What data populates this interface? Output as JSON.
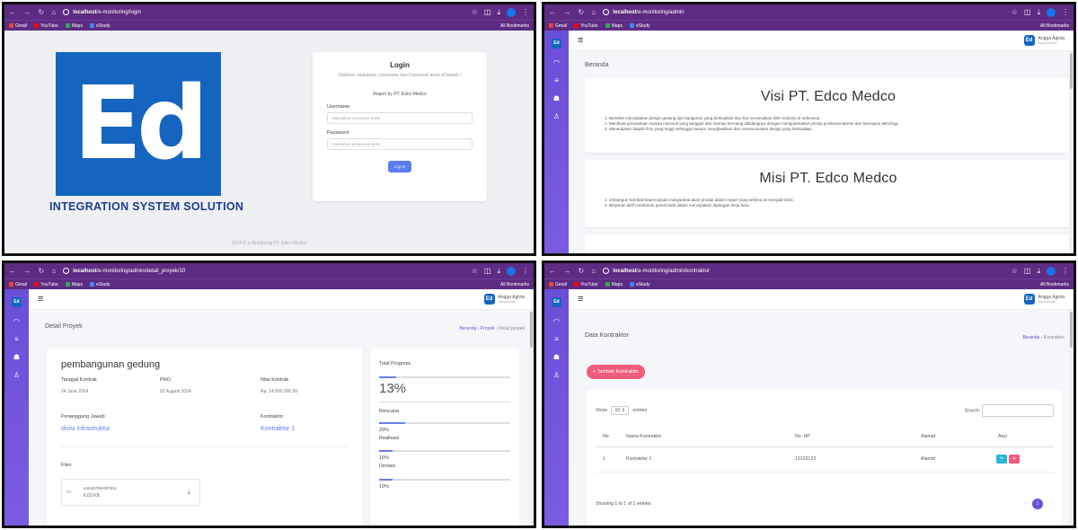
{
  "bookmarks": {
    "gmail": "Gmail",
    "youtube": "YouTube",
    "maps": "Maps",
    "estudy": "eStudy",
    "all": "All Bookmarks"
  },
  "p1": {
    "url_host": "localhost",
    "url_path": "/e-monitoring/login",
    "logo_text": "Ed",
    "tagline": "INTEGRATION SYSTEM SOLUTION",
    "login_title": "Login",
    "login_sub": "Silahkan masukkan Username dan Password anda di bawah !",
    "report": "Report by PT. Edco Medco",
    "username_label": "Username",
    "username_placeholder": "Masukkan username anda",
    "password_label": "Password",
    "password_placeholder": "Masukkan password anda",
    "login_button": "Log In",
    "footer": "2024 © e-Monitoring PT. Edco Medco"
  },
  "p2": {
    "url_host": "localhost",
    "url_path": "/e-monitoring/admin",
    "user_name": "Angga Agista",
    "user_role": "administrator",
    "page_title": "Beranda",
    "visi_title": "Visi PT. Edco Medco",
    "visi_items": [
      "1. Bertekat menciptakan design gedung dan bangunan yang berkualitas dan ikut meramaikan iklim industry di Indonesia.",
      "2. Membuat perusahaan swasta nasional yang tangguh dan mampu bersaing dibidangnya dengan mengutamakan prinsip professionalisme dan kemajuan teknologi.",
      "3. Menerapkan disiplin ilmu yang tinggi sehingga mampu menghasilkan dan merencanakan design yang berkualitas."
    ],
    "misi_title": "Misi PT. Edco Medco",
    "misi_items": [
      "1. embangun Kembali kepercayaan masyarakat akan produk dalam negeri yang selama ini menjadi krisis.",
      "2. Berperan aktif membantu pemerintah dalam menciptakan lapangan kerja baru."
    ]
  },
  "p3": {
    "url_host": "localhost",
    "url_path": "/e-monitoring/admin/detail_proyek/10",
    "user_name": "Angga Agista",
    "user_role": "administrator",
    "page_title": "Detail Proyek",
    "crumb": [
      "Beranda",
      "Proyek",
      "Detail proyek"
    ],
    "project_name": "pembangunan gedung",
    "tanggal_label": "Tanggal Kontrak",
    "tanggal_value": "24 June 2024",
    "pho_label": "PHO",
    "pho_value": "02 August 2024",
    "nilai_label": "Nilai Kontrak",
    "nilai_value": "Rp. 14.000.000,00",
    "pj_label": "Penanggung Jawab",
    "pj_value": "divisi infrastruktur",
    "kontraktor_label": "Kontraktor",
    "kontraktor_value": "Kontraktor 1",
    "files_label": "Files",
    "file_icon": "file",
    "file_name": "ee548769c597d4c",
    "file_size": "6.03 KB",
    "total_label": "Total Progress",
    "total_value": "13%",
    "total_pct": 13,
    "rencana_label": "Rencana",
    "rencana_value": "20%",
    "rencana_pct": 20,
    "realisasi_label": "Realisasi",
    "realisasi_value": "10%",
    "realisasi_pct": 10,
    "deviasi_label": "Deviasi",
    "deviasi_value": "10%",
    "deviasi_pct": 10
  },
  "p4": {
    "url_host": "localhost",
    "url_path": "/e-monitoring/admin/kontraktor",
    "user_name": "Angga Agista",
    "user_role": "administrator",
    "page_title": "Data Kontraktor",
    "crumb": [
      "Beranda",
      "Kontraktor"
    ],
    "add_button": "+ Tambah Kontraktor",
    "show_label": "Show",
    "show_value": "10",
    "entries_label": "entries",
    "search_label": "Search:",
    "headers": [
      "No",
      "Nama Kontraktor",
      "No. HP",
      "Alamat",
      "Aksi"
    ],
    "rows": [
      {
        "no": "1",
        "nama": "Kontraktor 1",
        "hp": "13123123",
        "alamat": "Alamat"
      }
    ],
    "info": "Showing 1 to 1 of 1 entries",
    "page": "1"
  }
}
